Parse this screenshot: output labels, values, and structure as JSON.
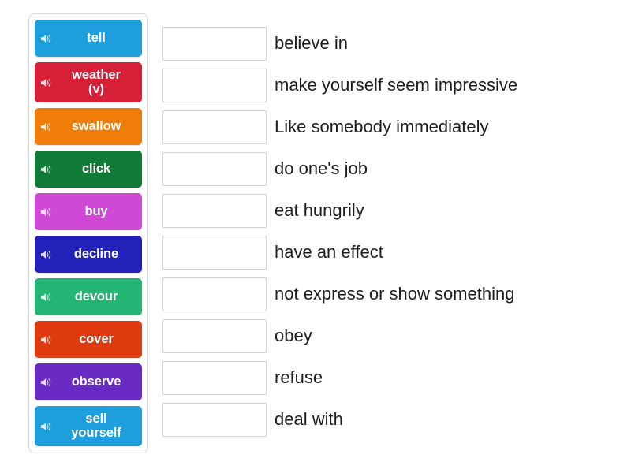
{
  "activity": {
    "type": "match-up-drag-and-drop",
    "background_color": "#ffffff",
    "panel_border_color": "#d8d8d8"
  },
  "tiles": [
    {
      "label": "tell",
      "color": "#1e9fdd",
      "icon": "speaker-icon",
      "lines": 1
    },
    {
      "label": "weather\n(v)",
      "color": "#d71f38",
      "icon": "speaker-icon",
      "lines": 2
    },
    {
      "label": "swallow",
      "color": "#f07d07",
      "icon": "speaker-icon",
      "lines": 1
    },
    {
      "label": "click",
      "color": "#107b37",
      "icon": "speaker-icon",
      "lines": 1
    },
    {
      "label": "buy",
      "color": "#cf48d6",
      "icon": "speaker-icon",
      "lines": 1
    },
    {
      "label": "decline",
      "color": "#2222bb",
      "icon": "speaker-icon",
      "lines": 1
    },
    {
      "label": "devour",
      "color": "#22b573",
      "icon": "speaker-icon",
      "lines": 1
    },
    {
      "label": "cover",
      "color": "#e03a10",
      "icon": "speaker-icon",
      "lines": 1
    },
    {
      "label": "observe",
      "color": "#6a2bc4",
      "icon": "speaker-icon",
      "lines": 1
    },
    {
      "label": "sell\nyourself",
      "color": "#1e9fdd",
      "icon": "speaker-icon",
      "lines": 2
    }
  ],
  "rows": [
    {
      "answer": "",
      "definition": "believe in"
    },
    {
      "answer": "",
      "definition": "make yourself seem impressive"
    },
    {
      "answer": "",
      "definition": "Like somebody immediately"
    },
    {
      "answer": "",
      "definition": "do one's job"
    },
    {
      "answer": "",
      "definition": "eat hungrily"
    },
    {
      "answer": "",
      "definition": "have an effect"
    },
    {
      "answer": "",
      "definition": "not express or show something"
    },
    {
      "answer": "",
      "definition": "obey"
    },
    {
      "answer": "",
      "definition": "refuse"
    },
    {
      "answer": "",
      "definition": "deal with"
    }
  ]
}
